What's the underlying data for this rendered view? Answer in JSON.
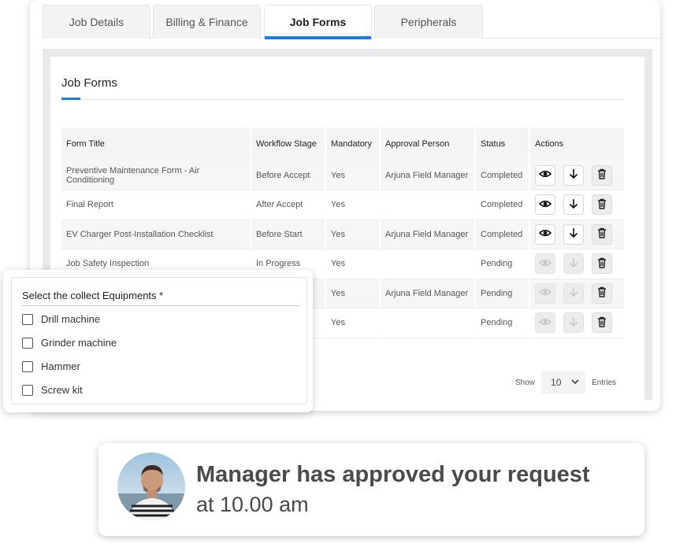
{
  "tabs": [
    {
      "label": "Job Details"
    },
    {
      "label": "Billing & Finance"
    },
    {
      "label": "Job Forms"
    },
    {
      "label": "Peripherals"
    }
  ],
  "active_tab": "Job Forms",
  "panel": {
    "title": "Job Forms"
  },
  "table": {
    "columns": [
      "Form Title",
      "Workflow Stage",
      "Mandatory",
      "Approval Person",
      "Status",
      "Actions"
    ],
    "rows": [
      {
        "title": "Preventive Maintenance Form - Air Conditioning",
        "stage": "Before Accept",
        "mandatory": "Yes",
        "approver": "Arjuna Field Manager",
        "status": "Completed"
      },
      {
        "title": "Final Report",
        "stage": "After Accept",
        "mandatory": "Yes",
        "approver": "",
        "status": "Completed"
      },
      {
        "title": "EV Charger Post-Installation Checklist",
        "stage": "Before Start",
        "mandatory": "Yes",
        "approver": "Arjuna Field Manager",
        "status": "Completed"
      },
      {
        "title": "Job Safety Inspection",
        "stage": "In Progress",
        "mandatory": "Yes",
        "approver": "",
        "status": "Pending"
      },
      {
        "title": "",
        "stage": "",
        "mandatory": "Yes",
        "approver": "Arjuna Field Manager",
        "status": "Pending"
      },
      {
        "title": "",
        "stage": "",
        "mandatory": "Yes",
        "approver": "",
        "status": "Pending"
      }
    ]
  },
  "pager": {
    "show_label": "Show",
    "value": "10",
    "entries_label": "Entries"
  },
  "checklist": {
    "title": "Select the collect Equipments *",
    "items": [
      {
        "label": "Drill machine",
        "checked": false
      },
      {
        "label": "Grinder machine",
        "checked": false
      },
      {
        "label": "Hammer",
        "checked": false
      },
      {
        "label": "Screw kit",
        "checked": false
      }
    ]
  },
  "toast": {
    "message": "Manager has approved your request",
    "time": "at 10.00 am"
  },
  "colors": {
    "accent": "#1a7ee6",
    "text_dark": "#4a4a4a",
    "panel_bg": "#e8e9eb"
  }
}
